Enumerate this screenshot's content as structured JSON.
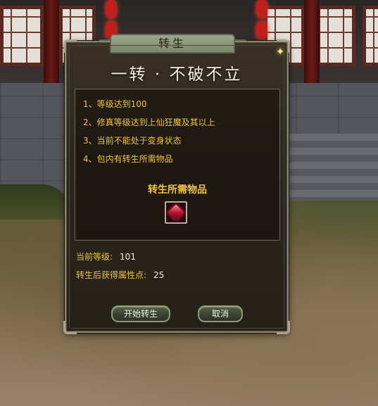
{
  "dialog": {
    "tab_title": "转生",
    "heading": "一转 · 不破不立",
    "requirements": [
      "1、等级达到100",
      "2、修真等级达到上仙狂魔及其以上",
      "3、当前不能处于变身状态",
      "4、包内有转生所需物品"
    ],
    "items_title": "转生所需物品",
    "item_icon": "red-gem-icon",
    "current_level_label": "当前等级:",
    "current_level_value": "101",
    "points_label": "转生后获得属性点:",
    "points_value": "25",
    "start_button": "开始转生",
    "cancel_button": "取消"
  },
  "colors": {
    "requirement_text": "#f0c43c",
    "value_text": "#f2efe6",
    "panel_bg": "#2c271e",
    "title_tab": "#8c9a7a"
  }
}
